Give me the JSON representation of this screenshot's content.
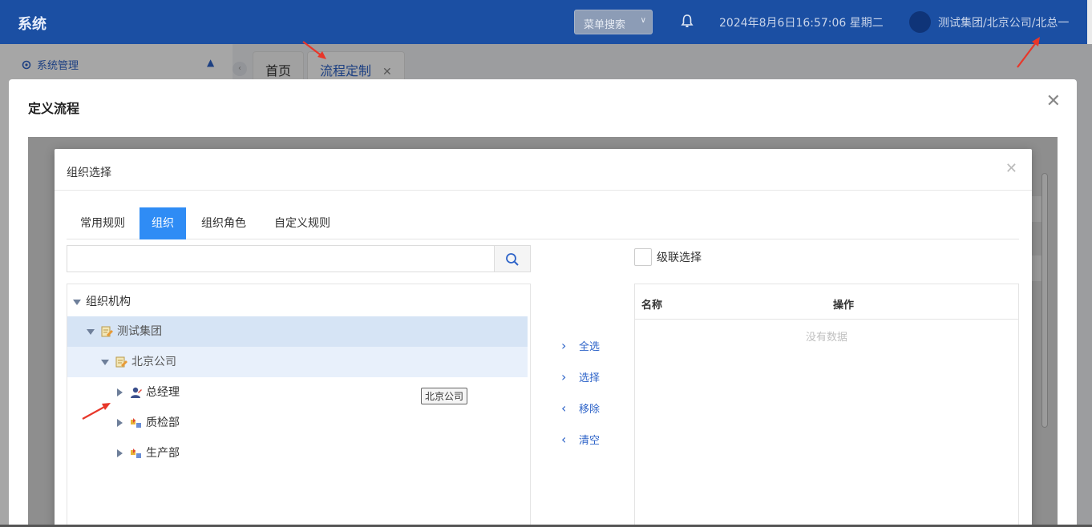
{
  "header": {
    "app_title": "系统",
    "menu_search_label": "菜单搜索",
    "datetime": "2024年8月6日16:57:06 星期二",
    "user_path": "测试集团/北京公司/北总一"
  },
  "sidenav": {
    "system_management": "系统管理"
  },
  "page_tabs": [
    {
      "label": "首页"
    },
    {
      "label": "流程定制"
    }
  ],
  "outer_modal": {
    "title": "定义流程"
  },
  "org_dialog": {
    "title": "组织选择",
    "tabs": [
      {
        "label": "常用规则",
        "active": false
      },
      {
        "label": "组织",
        "active": true
      },
      {
        "label": "组织角色",
        "active": false
      },
      {
        "label": "自定义规则",
        "active": false
      }
    ],
    "search": {
      "value": "",
      "placeholder": ""
    },
    "tree": {
      "root": "组织机构",
      "group": "测试集团",
      "company": "北京公司",
      "children": [
        "总经理",
        "质检部",
        "生产部"
      ]
    },
    "tooltip": "北京公司",
    "transfer_buttons": {
      "select_all": "全选",
      "select": "选择",
      "remove": "移除",
      "clear": "清空"
    },
    "cascade_label": "级联选择",
    "result_table": {
      "col_name": "名称",
      "col_action": "操作",
      "empty_text": "没有数据"
    }
  },
  "colors": {
    "header_bg": "#1b4fa3",
    "accent": "#2f8cf5",
    "link": "#2d63c8",
    "selected_row": "#d6e4f5",
    "annotation_arrow": "#e8372a"
  }
}
